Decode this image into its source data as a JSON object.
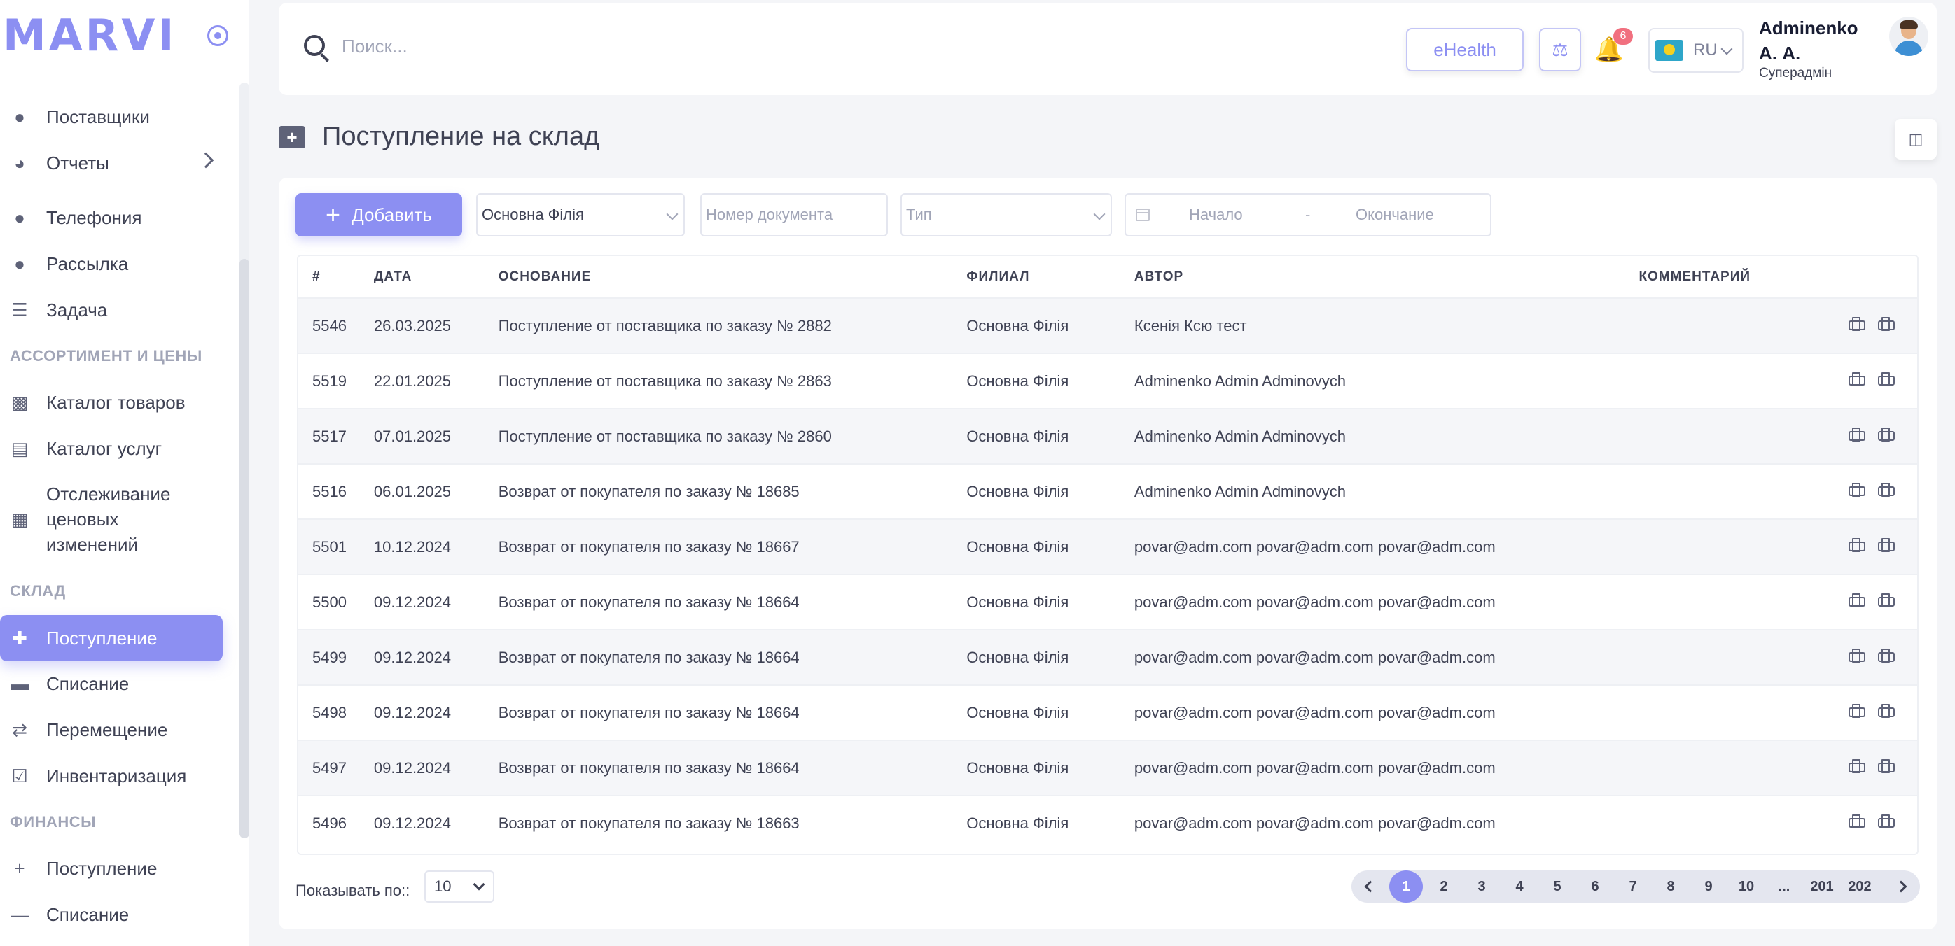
{
  "logo": "MARVI",
  "sidebar": {
    "items": [
      {
        "label": "Поставщики"
      },
      {
        "label": "Отчеты"
      },
      {
        "label": "Телефония"
      },
      {
        "label": "Рассылка"
      },
      {
        "label": "Задача"
      },
      {
        "label": "Каталог товаров"
      },
      {
        "label": "Каталог услуг"
      },
      {
        "label": "Отслеживание ценовых изменений"
      },
      {
        "label": "Поступление"
      },
      {
        "label": "Списание"
      },
      {
        "label": "Перемещение"
      },
      {
        "label": "Инвентаризация"
      },
      {
        "label": "Поступление"
      },
      {
        "label": "Списание"
      }
    ],
    "sections": [
      "АССОРТИМЕНТ И ЦЕНЫ",
      "СКЛАД",
      "ФИНАНСЫ"
    ]
  },
  "header": {
    "search_placeholder": "Поиск...",
    "ehealth": "eHealth",
    "notifications": "6",
    "lang": "RU",
    "user_name": "Adminenko А. А.",
    "user_role": "Суперадмін"
  },
  "page": {
    "title": "Поступление на склад"
  },
  "filters": {
    "add": "Добавить",
    "branch": "Основна Філія",
    "doc_placeholder": "Номер документа",
    "type_placeholder": "Тип",
    "start_placeholder": "Начало",
    "dash": "-",
    "end_placeholder": "Окончание"
  },
  "table": {
    "headers": [
      "#",
      "ДАТА",
      "ОСНОВАНИЕ",
      "ФИЛИАЛ",
      "АВТОР",
      "КОММЕНТАРИЙ"
    ],
    "rows": [
      [
        "5546",
        "26.03.2025",
        "Поступление от поставщика по заказу № 2882",
        "Основна Філія",
        "Ксенія Ксю тест",
        ""
      ],
      [
        "5519",
        "22.01.2025",
        "Поступление от поставщика по заказу № 2863",
        "Основна Філія",
        "Adminenko Admin Adminovych",
        ""
      ],
      [
        "5517",
        "07.01.2025",
        "Поступление от поставщика по заказу № 2860",
        "Основна Філія",
        "Adminenko Admin Adminovych",
        ""
      ],
      [
        "5516",
        "06.01.2025",
        "Возврат от покупателя по заказу № 18685",
        "Основна Філія",
        "Adminenko Admin Adminovych",
        ""
      ],
      [
        "5501",
        "10.12.2024",
        "Возврат от покупателя по заказу № 18667",
        "Основна Філія",
        "povar@adm.com povar@adm.com povar@adm.com",
        ""
      ],
      [
        "5500",
        "09.12.2024",
        "Возврат от покупателя по заказу № 18664",
        "Основна Філія",
        "povar@adm.com povar@adm.com povar@adm.com",
        ""
      ],
      [
        "5499",
        "09.12.2024",
        "Возврат от покупателя по заказу № 18664",
        "Основна Філія",
        "povar@adm.com povar@adm.com povar@adm.com",
        ""
      ],
      [
        "5498",
        "09.12.2024",
        "Возврат от покупателя по заказу № 18664",
        "Основна Філія",
        "povar@adm.com povar@adm.com povar@adm.com",
        ""
      ],
      [
        "5497",
        "09.12.2024",
        "Возврат от покупателя по заказу № 18664",
        "Основна Філія",
        "povar@adm.com povar@adm.com povar@adm.com",
        ""
      ],
      [
        "5496",
        "09.12.2024",
        "Возврат от покупателя по заказу № 18663",
        "Основна Філія",
        "povar@adm.com povar@adm.com povar@adm.com",
        ""
      ]
    ]
  },
  "footer": {
    "show_label": "Показывать по::",
    "per_page": "10",
    "pages": [
      "1",
      "2",
      "3",
      "4",
      "5",
      "6",
      "7",
      "8",
      "9",
      "10",
      "...",
      "201",
      "202"
    ],
    "current_page": "1"
  },
  "colors": {
    "accent": "#8c8ff2",
    "badge": "#f1707f"
  }
}
